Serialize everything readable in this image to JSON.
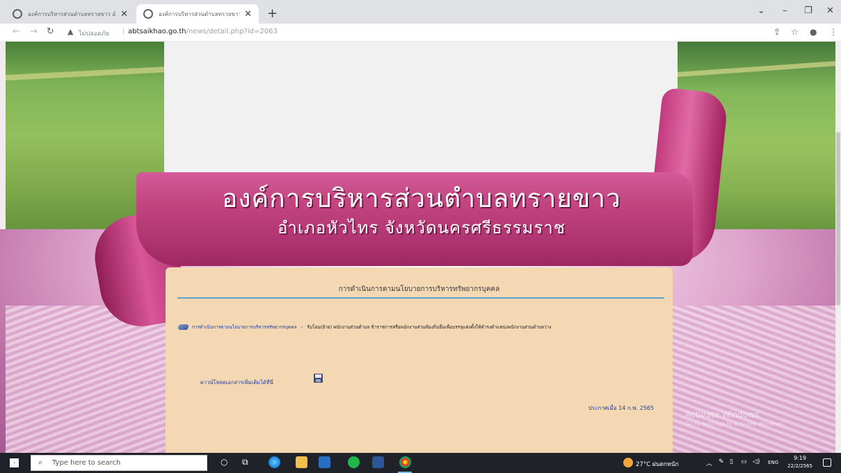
{
  "browser": {
    "tabs": [
      {
        "title": "องค์การบริหารส่วนตำบลทรายขาว อำเ",
        "active": false
      },
      {
        "title": "องค์การบริหารส่วนตำบลทรายขาว อำเ",
        "active": true
      }
    ],
    "new_tab_symbol": "+",
    "window_controls": {
      "collapse": "⌄",
      "minimize": "–",
      "maximize": "❐",
      "close": "✕"
    },
    "address": {
      "security_label": "ไม่ปลอดภัย",
      "host": "abtsaikhao.go.th",
      "path": "/news/detail.php?id=2063"
    }
  },
  "site": {
    "title": "องค์การบริหารส่วนตำบลทรายขาว",
    "subtitle": "อำเภอหัวไทร  จังหวัดนครศรีธรรมราช"
  },
  "article": {
    "heading": "การดำเนินการตามนโยบายการบริหารทรัพยากรบุคคล",
    "breadcrumb": {
      "parent": "การดำเนินการตามนโยบายการบริหารทรัพยากรบุคคล",
      "separator": "›",
      "current": "รับโอน(ย้าย) พนักงานส่วนตำบล ข้าราชการหรือพนักงานส่วนท้องถิ่นอื่นเพื่อบรรจุแต่งตั้งให้ดำรงตำแหน่งพนักงานส่วนตำบลว่าง"
    },
    "download_label": "ดาวน์โหลดเอกสารเพิ่มเติมได้ที่นี่",
    "announce_date": "ประกาศเมื่อ 14 ก.พ. 2565"
  },
  "watermark": {
    "line1": "Activate Windows",
    "line2": "Go to Settings to activate Windows."
  },
  "taskbar": {
    "search_placeholder": "Type here to search",
    "weather": "27°C  ฝนตกหนัก",
    "language": "ENG",
    "time": "9:19",
    "date": "22/2/2565"
  },
  "colors": {
    "content_bg": "#f4d8b4",
    "link": "#1f3e9e",
    "rule": "#5fa4c8",
    "ribbon": "#c1447f"
  }
}
